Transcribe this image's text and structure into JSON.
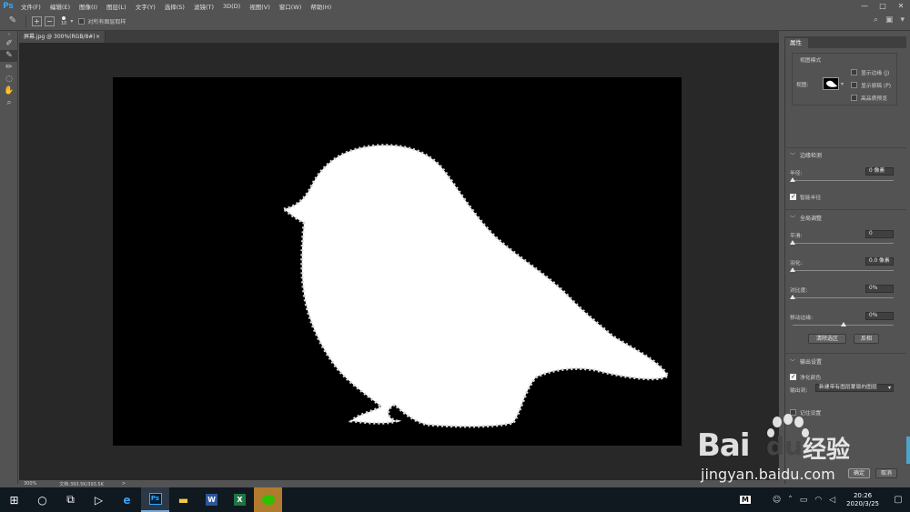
{
  "app": {
    "logo": "Ps",
    "menu": [
      "文件(F)",
      "编辑(E)",
      "图像(I)",
      "图层(L)",
      "文字(Y)",
      "选择(S)",
      "滤镜(T)",
      "3D(D)",
      "视图(V)",
      "窗口(W)",
      "帮助(H)"
    ],
    "window_controls": [
      "—",
      "□",
      "✕"
    ]
  },
  "options_bar": {
    "brush_size": "10",
    "sample_all_layers_label": "对所有图层取样",
    "sample_all_layers_checked": false
  },
  "document": {
    "tab_title": "屏幕.jpg @ 300%(RGB/8#)",
    "close": "×",
    "zoom": "300%",
    "doc_info": "文档:393.5K/393.5K",
    "arrow": ">"
  },
  "properties_panel": {
    "tab": "属性",
    "view_mode": {
      "title": "视图模式",
      "view_label": "视图:",
      "show_edges": "显示边缘 (J)",
      "show_original": "显示原稿 (P)",
      "high_quality": "高品质预览"
    },
    "edge_detection": {
      "title": "边缘检测",
      "radius_label": "半径:",
      "radius_value": "0 像素",
      "radius_fraction": 0.0,
      "smart_radius_label": "智能半径",
      "smart_radius_checked": true
    },
    "global_refinement": {
      "title": "全局调整",
      "smooth_label": "平滑:",
      "smooth_value": "0",
      "smooth_fraction": 0.0,
      "feather_label": "羽化:",
      "feather_value": "0.0 像素",
      "feather_fraction": 0.0,
      "contrast_label": "对比度:",
      "contrast_value": "0%",
      "contrast_fraction": 0.0,
      "shift_edge_label": "移动边缘:",
      "shift_edge_value": "0%",
      "shift_edge_fraction": 0.5,
      "clear_selection": "清除选区",
      "invert": "反相"
    },
    "output": {
      "title": "输出设置",
      "decontaminate_label": "净化颜色",
      "decontaminate_checked": true,
      "output_to_label": "输出到:",
      "output_to_value": "新建带有图层蒙版的图层",
      "remember_label": "记住设置",
      "remember_checked": false
    },
    "ok": "确定",
    "cancel": "取消"
  },
  "taskbar": {
    "ime": "M",
    "time": "20:26",
    "date": "2020/3/25"
  },
  "watermark": {
    "brand": "Bai",
    "brand2": "du",
    "cn": "经验",
    "url": "jingyan.baidu.com"
  },
  "colors": {
    "ps_blue": "#31a8ff",
    "canvas_bg": "#282828",
    "panel_bg": "#535353",
    "taskbar_bg": "#101820"
  }
}
